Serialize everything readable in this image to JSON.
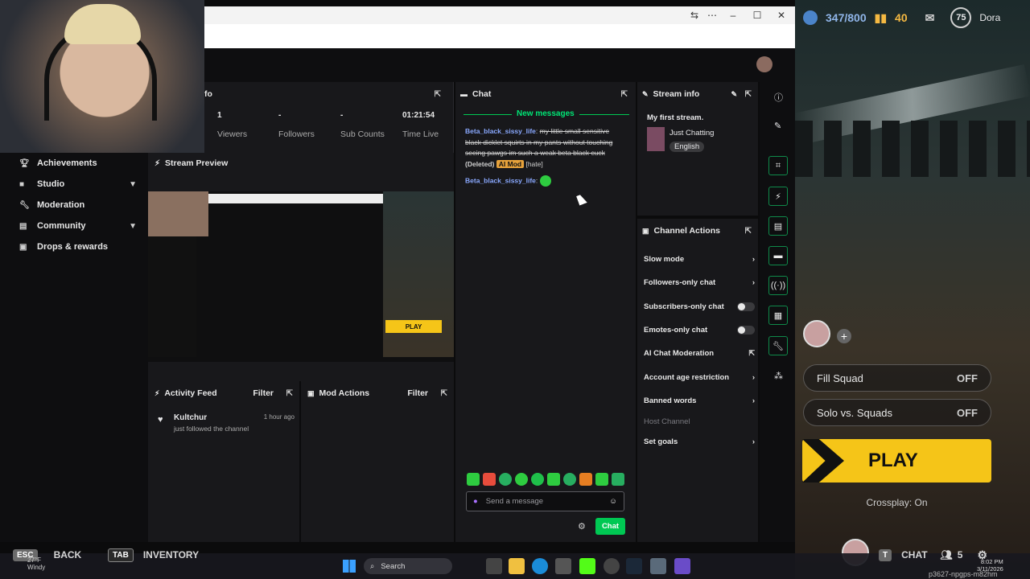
{
  "game": {
    "currency_count": "347/800",
    "vbucks": "40",
    "level": "75",
    "player_name": "Dora",
    "modes": [
      {
        "name": "Fill Squad",
        "state": "OFF"
      },
      {
        "name": "Solo vs. Squads",
        "state": "OFF"
      }
    ],
    "play_label": "PLAY",
    "crossplay": "Crossplay: On",
    "hints": {
      "esc": "ESC",
      "back": "BACK",
      "tab": "TAB",
      "inventory": "INVENTORY",
      "t_key": "T",
      "chat": "CHAT",
      "party_count": "5"
    }
  },
  "nav": {
    "items": [
      {
        "label": "Achievements",
        "icon": "trophy-icon"
      },
      {
        "label": "Studio",
        "icon": "studio-icon",
        "expandable": true
      },
      {
        "label": "Moderation",
        "icon": "wrench-icon"
      },
      {
        "label": "Community",
        "icon": "community-icon",
        "expandable": true
      },
      {
        "label": "Drops & rewards",
        "icon": "gift-icon"
      }
    ]
  },
  "stats": {
    "header_fragment": "fo",
    "items": [
      {
        "value": "1",
        "label": "Viewers"
      },
      {
        "value": "-",
        "label": "Followers"
      },
      {
        "value": "-",
        "label": "Sub Counts"
      },
      {
        "value": "01:21:54",
        "label": "Time Live"
      }
    ]
  },
  "preview": {
    "title": "Stream Preview",
    "inner_play": "PLAY"
  },
  "activity": {
    "title": "Activity Feed",
    "filter": "Filter",
    "items": [
      {
        "user": "Kultchur",
        "text": "just followed the channel",
        "time": "1 hour ago"
      }
    ]
  },
  "mod_actions": {
    "title": "Mod Actions",
    "filter": "Filter"
  },
  "chat": {
    "title": "Chat",
    "new_messages": "New messages",
    "messages": [
      {
        "user": "Beta_black_sissy_life",
        "text": "my little small sensitive black dicklet squirts in my pants without touching seeing pawgs im such a weak beta black cuck",
        "deleted": "(Deleted)",
        "badge": "AI Mod",
        "tag": "[hate]"
      },
      {
        "user": "Beta_black_sissy_life",
        "text": ""
      }
    ],
    "input_placeholder": "Send a message",
    "send_label": "Chat"
  },
  "stream_info": {
    "title": "Stream info",
    "stream_title": "My first stream.",
    "category": "Just Chatting",
    "language": "English"
  },
  "channel_actions": {
    "title": "Channel Actions",
    "items": [
      {
        "label": "Slow mode",
        "control": "chevron"
      },
      {
        "label": "Followers-only chat",
        "control": "chevron"
      },
      {
        "label": "Subscribers-only chat",
        "control": "toggle"
      },
      {
        "label": "Emotes-only chat",
        "control": "toggle"
      },
      {
        "label": "AI Chat Moderation",
        "control": "external"
      },
      {
        "label": "Account age restriction",
        "control": "chevron"
      },
      {
        "label": "Banned words",
        "control": "chevron"
      },
      {
        "label": "Host Channel",
        "control": "none"
      },
      {
        "label": "Set goals",
        "control": "chevron"
      }
    ]
  },
  "taskbar": {
    "weather_temp": "27°F",
    "weather_desc": "Windy",
    "search": "Search",
    "time": "8:02 PM",
    "date": "3/11/2026",
    "watermark": "p3627-npgps-m82hm"
  },
  "colors": {
    "accent": "#00e676",
    "play_yellow": "#f5c518",
    "username": "#8aa9ff"
  }
}
